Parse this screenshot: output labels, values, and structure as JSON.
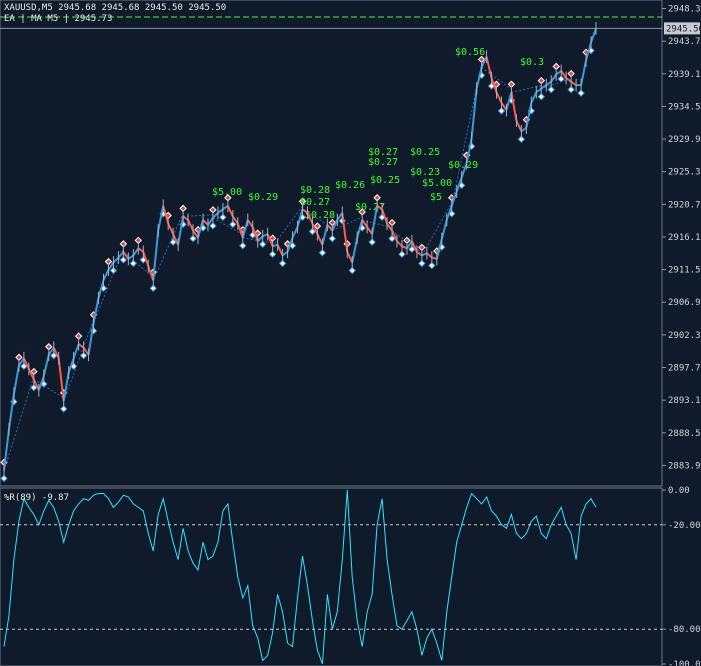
{
  "window": {
    "symbol_line": "XAUUSD,M5  2945.68 2945.68 2945.50 2945.50",
    "ea_line": "EA | MA M5 | 2945.73"
  },
  "colors": {
    "background": "#0f1a2a",
    "grid": "#1e2b3d",
    "axis_text": "#d0d6dd",
    "candle_up": "#3a9ad9",
    "candle_down": "#e0483a",
    "price_line": "#ff5a4a",
    "indicator_line": "#2ee6ff",
    "green_levels": "#3cff2a",
    "trade_markers": "#ffffff"
  },
  "price_axis": {
    "ticks": [
      "2948.30",
      "2943.70",
      "2939.10",
      "2934.50",
      "2929.90",
      "2925.30",
      "2920.70",
      "2916.10",
      "2911.50",
      "2906.90",
      "2902.30",
      "2897.70",
      "2893.10",
      "2888.50",
      "2883.90"
    ],
    "current_price": "2945.50",
    "ylim": [
      2881.0,
      2949.5
    ]
  },
  "green_labels": [
    "$0.56",
    "$0.3",
    "$0.27",
    "$0.27",
    "$0.25",
    "$0.23",
    "$5.00",
    "$0.29",
    "$0.28",
    "$0.27",
    "$0.26",
    "$0.25",
    "$5.00",
    "$0.29",
    "$5",
    "$0.28",
    "$0.27"
  ],
  "indicator": {
    "label": "%R(89) -9.87",
    "ticks": [
      "0.00",
      "-20.00",
      "-80.00",
      "-100.00"
    ],
    "levels": [
      -20,
      -80
    ],
    "ylim": [
      -100,
      0
    ]
  },
  "chart_data": [
    {
      "type": "line",
      "title": "XAUUSD,M5",
      "xlabel": "",
      "ylabel": "",
      "ylim": [
        2881.0,
        2949.5
      ],
      "x": [
        0,
        5,
        10,
        15,
        20,
        25,
        30,
        35,
        40,
        45,
        50,
        55,
        60,
        65,
        70,
        75,
        80,
        85,
        90,
        95,
        100,
        105,
        110,
        115,
        120,
        125,
        130,
        135,
        140,
        145,
        150,
        155,
        160,
        165,
        170,
        175,
        180,
        185,
        190,
        195,
        200,
        205,
        210,
        215,
        220,
        225,
        230,
        235,
        240,
        245,
        250,
        255,
        260,
        265,
        270,
        275,
        280,
        285,
        290,
        295,
        300,
        305,
        310,
        315,
        320,
        325,
        330,
        335,
        340,
        345,
        350,
        355,
        360,
        365,
        370,
        375,
        380,
        385,
        390,
        395,
        400,
        405,
        410,
        415,
        420,
        425,
        430,
        435,
        440,
        445,
        450,
        455,
        460,
        465,
        470,
        475,
        480,
        485,
        490,
        495,
        500,
        505,
        510,
        515,
        520,
        525,
        530,
        535,
        540,
        545,
        550,
        555,
        560,
        565,
        570,
        575,
        580,
        585,
        590,
        595
      ],
      "series": [
        {
          "values": [
            2883.2,
            2889.0,
            2894.0,
            2898.0,
            2899.0,
            2897.5,
            2896.0,
            2894.5,
            2896.5,
            2899.5,
            2900.5,
            2899.0,
            2893.0,
            2897.0,
            2899.0,
            2901.0,
            2900.5,
            2899.5,
            2904.0,
            2907.5,
            2910.0,
            2911.5,
            2912.5,
            2913.2,
            2914.0,
            2913.0,
            2913.5,
            2914.5,
            2914.0,
            2912.0,
            2910.0,
            2917.0,
            2920.5,
            2918.0,
            2916.5,
            2915.0,
            2919.0,
            2918.5,
            2917.0,
            2916.0,
            2918.5,
            2917.8,
            2918.8,
            2919.5,
            2920.0,
            2920.5,
            2919.0,
            2918.0,
            2916.0,
            2918.5,
            2917.5,
            2915.5,
            2916.2,
            2916.5,
            2914.8,
            2915.0,
            2913.5,
            2914.0,
            2916.0,
            2917.5,
            2920.0,
            2919.5,
            2918.0,
            2916.5,
            2915.0,
            2917.8,
            2917.0,
            2918.5,
            2919.5,
            2914.0,
            2912.5,
            2916.0,
            2918.5,
            2917.5,
            2916.5,
            2920.5,
            2920.0,
            2918.0,
            2917.0,
            2915.5,
            2914.8,
            2914.5,
            2915.5,
            2914.0,
            2913.5,
            2913.8,
            2913.2,
            2913.0,
            2915.8,
            2918.5,
            2920.5,
            2922.5,
            2924.5,
            2926.5,
            2930.0,
            2937.0,
            2940.0,
            2941.5,
            2938.5,
            2936.5,
            2935.0,
            2934.0,
            2936.5,
            2932.5,
            2931.0,
            2931.5,
            2935.0,
            2936.5,
            2937.0,
            2937.5,
            2938.0,
            2939.0,
            2939.5,
            2938.5,
            2938.0,
            2937.5,
            2937.5,
            2941.0,
            2943.5,
            2945.5
          ],
          "name": ""
        }
      ]
    },
    {
      "type": "line",
      "title": "%R(89) -9.87",
      "xlabel": "",
      "ylabel": "",
      "ylim": [
        -100,
        0
      ],
      "x": [
        0,
        5,
        10,
        15,
        20,
        25,
        30,
        35,
        40,
        45,
        50,
        55,
        60,
        65,
        70,
        75,
        80,
        85,
        90,
        95,
        100,
        105,
        110,
        115,
        120,
        125,
        130,
        135,
        140,
        145,
        150,
        155,
        160,
        165,
        170,
        175,
        180,
        185,
        190,
        195,
        200,
        205,
        210,
        215,
        220,
        225,
        230,
        235,
        240,
        245,
        250,
        255,
        260,
        265,
        270,
        275,
        280,
        285,
        290,
        295,
        300,
        305,
        310,
        315,
        320,
        325,
        330,
        335,
        340,
        345,
        350,
        355,
        360,
        365,
        370,
        375,
        380,
        385,
        390,
        395,
        400,
        405,
        410,
        415,
        420,
        425,
        430,
        435,
        440,
        445,
        450,
        455,
        460,
        465,
        470,
        475,
        480,
        485,
        490,
        495,
        500,
        505,
        510,
        515,
        520,
        525,
        530,
        535,
        540,
        545,
        550,
        555,
        560,
        565,
        570,
        575,
        580,
        585,
        590,
        595
      ],
      "series": [
        {
          "values": [
            -90,
            -72,
            -40,
            -18,
            -5,
            -10,
            -14,
            -20,
            -12,
            -6,
            -10,
            -18,
            -30,
            -20,
            -12,
            -8,
            -5,
            -6,
            -3,
            -2,
            -2,
            -5,
            -10,
            -7,
            -3,
            -4,
            -8,
            -10,
            -12,
            -25,
            -35,
            -14,
            -5,
            -18,
            -30,
            -40,
            -22,
            -35,
            -42,
            -46,
            -30,
            -40,
            -38,
            -30,
            -12,
            -8,
            -30,
            -50,
            -62,
            -55,
            -78,
            -85,
            -98,
            -95,
            -82,
            -60,
            -70,
            -88,
            -90,
            -62,
            -38,
            -55,
            -75,
            -92,
            -100,
            -60,
            -80,
            -70,
            -40,
            0,
            -50,
            -75,
            -90,
            -70,
            -60,
            -20,
            -5,
            -40,
            -60,
            -78,
            -80,
            -75,
            -70,
            -80,
            -95,
            -85,
            -80,
            -88,
            -98,
            -70,
            -50,
            -30,
            -20,
            -10,
            -2,
            -5,
            -8,
            -4,
            -12,
            -15,
            -20,
            -22,
            -14,
            -25,
            -28,
            -25,
            -18,
            -15,
            -25,
            -28,
            -20,
            -15,
            -10,
            -20,
            -25,
            -40,
            -15,
            -8,
            -5,
            -9.87
          ],
          "name": ""
        }
      ]
    }
  ]
}
